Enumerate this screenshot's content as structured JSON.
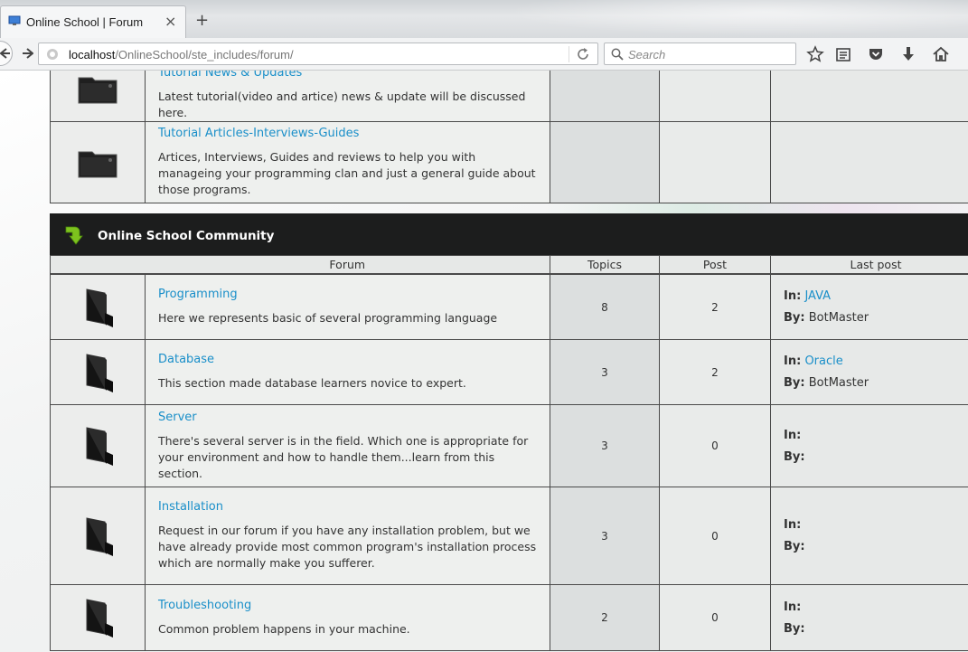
{
  "browser": {
    "tab_title": "Online School | Forum",
    "tab_close": "×",
    "new_tab": "+",
    "url_host": "localhost",
    "url_path": "/OnlineSchool/ste_includes/forum/",
    "search_placeholder": "Search"
  },
  "top_category": {
    "forums": [
      {
        "title": "Tutorial News & Updates",
        "description": "Latest tutorial(video and artice) news & update will be discussed here."
      },
      {
        "title": "Tutorial Articles-Interviews-Guides",
        "description": "Artices, Interviews, Guides and reviews to help you with manageing your programming clan and just a general guide about those programs."
      }
    ]
  },
  "community": {
    "title": "Online School Community",
    "headers": {
      "forum": "Forum",
      "topics": "Topics",
      "post": "Post",
      "last_post": "Last post"
    },
    "in_label": "In:",
    "by_label": "By:",
    "forums": [
      {
        "title": "Programming",
        "description": "Here we represents basic of several programming language",
        "topics": "8",
        "posts": "2",
        "in": "JAVA",
        "by": "BotMaster"
      },
      {
        "title": "Database",
        "description": "This section made database learners novice to expert.",
        "topics": "3",
        "posts": "2",
        "in": "Oracle",
        "by": "BotMaster"
      },
      {
        "title": "Server",
        "description": "There's several server is in the field. Which one is appropriate for your environment and how to handle them...learn from this section.",
        "topics": "3",
        "posts": "0",
        "in": "",
        "by": ""
      },
      {
        "title": "Installation",
        "description": "Request in our forum if you have any installation problem, but we have already provide most common program's installation process which are normally make you sufferer.",
        "topics": "3",
        "posts": "0",
        "in": "",
        "by": ""
      },
      {
        "title": "Troubleshooting",
        "description": "Common problem happens in your machine.",
        "topics": "2",
        "posts": "0",
        "in": "",
        "by": ""
      }
    ]
  }
}
